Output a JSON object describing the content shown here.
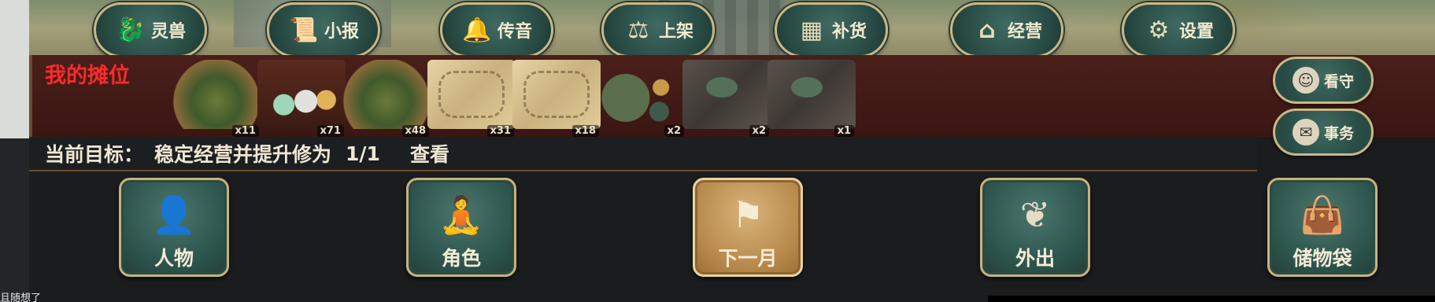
{
  "top_nav": [
    {
      "label": "灵兽",
      "icon": "beast-icon"
    },
    {
      "label": "小报",
      "icon": "newspaper-icon"
    },
    {
      "label": "传音",
      "icon": "bell-icon"
    },
    {
      "label": "上架",
      "icon": "scale-icon"
    },
    {
      "label": "补货",
      "icon": "crate-icon"
    },
    {
      "label": "经营",
      "icon": "shop-icon"
    },
    {
      "label": "设置",
      "icon": "gear-icon"
    }
  ],
  "stall": {
    "title": "我的摊位",
    "items": [
      {
        "name": "herb-bundle",
        "qty": "x11"
      },
      {
        "name": "potion-chest",
        "qty": "x71"
      },
      {
        "name": "herb-bundle",
        "qty": "x48"
      },
      {
        "name": "bone-scroll",
        "qty": "x31"
      },
      {
        "name": "bone-scroll",
        "qty": "x18"
      },
      {
        "name": "jade-set",
        "qty": "x2"
      },
      {
        "name": "ore-pile",
        "qty": "x2"
      },
      {
        "name": "ore-pile",
        "qty": "x1"
      }
    ]
  },
  "side_buttons": [
    {
      "label": "看守",
      "icon": "guard-icon"
    },
    {
      "label": "事务",
      "icon": "scroll-icon"
    }
  ],
  "goal": {
    "label": "当前目标：",
    "text": "稳定经营并提升修为",
    "progress": "1/1",
    "view": "查看"
  },
  "bottom_nav": [
    {
      "label": "人物",
      "icon": "person-icon"
    },
    {
      "label": "角色",
      "icon": "character-icon"
    },
    {
      "label": "下一月",
      "icon": "flag-icon"
    },
    {
      "label": "外出",
      "icon": "travel-icon"
    },
    {
      "label": "储物袋",
      "icon": "bag-icon"
    }
  ],
  "footer": {
    "tiny_text": "且随想了"
  },
  "colors": {
    "stall_bg": "#4a1f1a",
    "pill_bg": "#274a43",
    "pill_border": "#c9b786",
    "highlight_button": "#b88a4c",
    "stall_title": "#ff2a2a"
  }
}
